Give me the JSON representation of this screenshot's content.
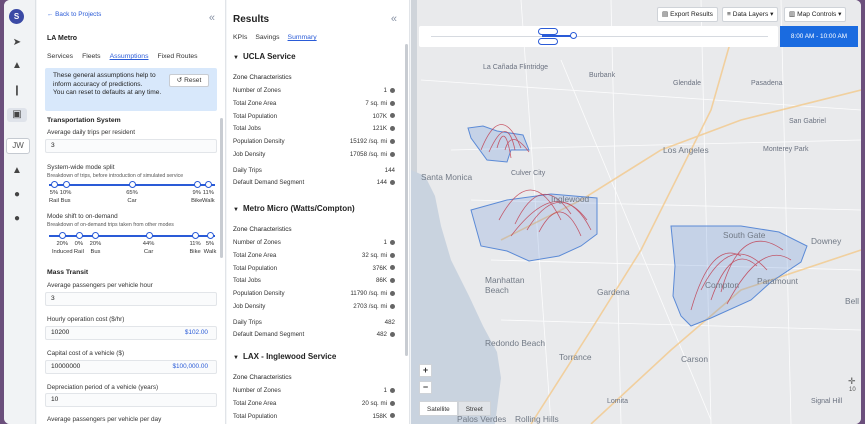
{
  "rail": {
    "logo": "S",
    "user": "JW",
    "icons": [
      "rocket-icon",
      "send-icon",
      "chart-icon",
      "transit-icon",
      "bell-icon",
      "user-icon",
      "help-icon"
    ]
  },
  "left": {
    "back_label": "← Back to Projects",
    "collapse_glyph": "«",
    "project_name": "LA Metro",
    "tabs": [
      "Services",
      "Fleets",
      "Assumptions",
      "Fixed Routes"
    ],
    "info_lines": [
      "These general assumptions help to",
      "inform accuracy of predictions.",
      "You can reset to defaults at any time."
    ],
    "reset_label": "Reset",
    "reset_glyph": "↺",
    "transport_heading": "Transportation System",
    "avg_trips_label": "Average daily trips per resident",
    "avg_trips_value": "3",
    "mode_split_label": "System-wide mode split",
    "mode_split_sub": "Breakdown of trips, before introduction of simulated service",
    "mode_split": [
      {
        "pct": "5%",
        "name": "Rail",
        "level": 0.03
      },
      {
        "pct": "10%",
        "name": "Bus",
        "level": 0.1
      },
      {
        "pct": "65%",
        "name": "Car",
        "level": 0.5
      },
      {
        "pct": "9%",
        "name": "Bike",
        "level": 0.89
      },
      {
        "pct": "11%",
        "name": "Walk",
        "level": 0.96
      }
    ],
    "shift_label": "Mode shift to on-demand",
    "shift_sub": "Breakdown of on-demand trips taken from other modes",
    "shift": [
      {
        "pct": "20%",
        "name": "Induced",
        "level": 0.08
      },
      {
        "pct": "0%",
        "name": "Rail",
        "level": 0.18
      },
      {
        "pct": "20%",
        "name": "Bus",
        "level": 0.28
      },
      {
        "pct": "44%",
        "name": "Car",
        "level": 0.6
      },
      {
        "pct": "11%",
        "name": "Bike",
        "level": 0.88
      },
      {
        "pct": "5%",
        "name": "Walk",
        "level": 0.97
      }
    ],
    "mass_heading": "Mass Transit",
    "avg_pass_label": "Average passengers per vehicle hour",
    "avg_pass_value": "3",
    "hourly_label": "Hourly operation cost ($/hr)",
    "hourly_value": "10200",
    "hourly_money": "$102.00",
    "capital_label": "Capital cost of a vehicle ($)",
    "capital_value": "10000000",
    "capital_money": "$100,000.00",
    "deprec_label": "Depreciation period of a vehicle (years)",
    "deprec_value": "10",
    "avg_day_label": "Average passengers per vehicle per day"
  },
  "results": {
    "title": "Results",
    "collapse_glyph": "«",
    "tabs": [
      "KPIs",
      "Savings",
      "Summary"
    ],
    "zone_heading": "Zone Characteristics",
    "sections": [
      {
        "name": "UCLA Service",
        "rows": [
          [
            "Number of Zones",
            "1"
          ],
          [
            "Total Zone Area",
            "7 sq. mi"
          ],
          [
            "Total Population",
            "107K"
          ],
          [
            "Total Jobs",
            "121K"
          ],
          [
            "Population Density",
            "15192 /sq. mi"
          ],
          [
            "Job Density",
            "17058 /sq. mi"
          ]
        ],
        "trips": [
          "Daily Trips",
          "144"
        ],
        "demand": [
          "Default Demand Segment",
          "144"
        ]
      },
      {
        "name": "Metro Micro (Watts/Compton)",
        "rows": [
          [
            "Number of Zones",
            "1"
          ],
          [
            "Total Zone Area",
            "32 sq. mi"
          ],
          [
            "Total Population",
            "376K"
          ],
          [
            "Total Jobs",
            "86K"
          ],
          [
            "Population Density",
            "11790 /sq. mi"
          ],
          [
            "Job Density",
            "2703 /sq. mi"
          ]
        ],
        "trips": [
          "Daily Trips",
          "482"
        ],
        "demand": [
          "Default Demand Segment",
          "482"
        ]
      },
      {
        "name": "LAX - Inglewood Service",
        "rows": [
          [
            "Number of Zones",
            "1"
          ],
          [
            "Total Zone Area",
            "20 sq. mi"
          ],
          [
            "Total Population",
            "158K"
          ]
        ]
      }
    ]
  },
  "map": {
    "export_label": "Export Results",
    "layers_label": "Data Layers",
    "controls_label": "Map Controls",
    "time_label": "8:00 AM - 10:00 AM",
    "zoom_in": "+",
    "zoom_out": "−",
    "satellite": "Satellite",
    "street": "Street",
    "scale_label": "10",
    "places": [
      "La Cañada Flintridge",
      "Burbank",
      "Glendale",
      "Pasadena",
      "Los Angeles",
      "San Gabriel",
      "Monterey Park",
      "Santa Monica",
      "Culver City",
      "Inglewood",
      "South Gate",
      "Downey",
      "Compton",
      "Paramount",
      "Manhattan Beach",
      "Gardena",
      "Redondo Beach",
      "Torrance",
      "Carson",
      "Bell",
      "Lomita",
      "Rolling Hills",
      "Signal Hill",
      "Palos Verdes"
    ],
    "colors": {
      "zone": "#5b8ad6",
      "arc": "#c0394b",
      "primary": "#1a6be0"
    }
  }
}
